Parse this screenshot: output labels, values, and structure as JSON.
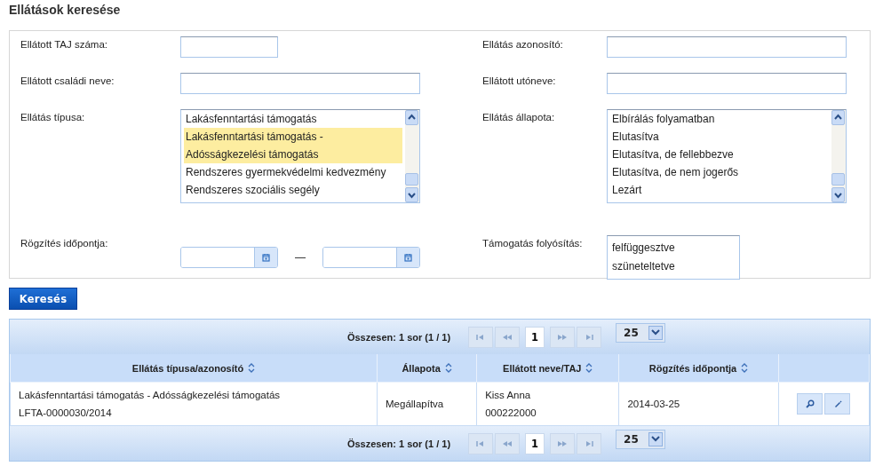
{
  "title": "Ellátások keresése",
  "form_rows": [
    {
      "left": {
        "kind": "text",
        "label": "Ellátott TAJ száma:"
      },
      "right": {
        "kind": "text",
        "label": "Ellátás azonosító:"
      }
    },
    {
      "left": {
        "kind": "text",
        "label": "Ellátott családi neve:"
      },
      "right": {
        "kind": "text",
        "label": "Ellátott utóneve:"
      }
    },
    {
      "left": {
        "kind": "listbox",
        "label": "Ellátás típusa:",
        "items": [
          {
            "text": "Lakásfenntartási támogatás",
            "selected": false
          },
          {
            "text": "Lakásfenntartási támogatás - Adósságkezelési támogatás",
            "selected": true
          },
          {
            "text": "Rendszeres gyermekvédelmi kedvezmény",
            "selected": false
          },
          {
            "text": "Rendszeres szociális segély",
            "selected": false
          }
        ]
      },
      "right": {
        "kind": "listbox",
        "label": "Ellátás állapota:",
        "items": [
          {
            "text": "Elbírálás folyamatban",
            "selected": false
          },
          {
            "text": "Elutasítva",
            "selected": false
          },
          {
            "text": "Elutasítva, de fellebbezve",
            "selected": false
          },
          {
            "text": "Elutasítva, de nem jogerős",
            "selected": false
          },
          {
            "text": "Lezárt",
            "selected": false
          }
        ]
      }
    },
    {
      "left": {
        "kind": "date-range",
        "label": "Rögzítés időpontja:",
        "separator": "—"
      },
      "right": {
        "kind": "list",
        "label": "Támogatás folyósítás:",
        "items": [
          {
            "text": "felfüggesztve",
            "selected": false
          },
          {
            "text": "szüneteltetve",
            "selected": false
          }
        ]
      }
    }
  ],
  "search_button": "Keresés",
  "paginator": {
    "summary": "Összesen: 1 sor (1 / 1)",
    "page": "1",
    "rows_per_page": "25"
  },
  "table": {
    "columns": [
      "Ellátás típusa/azonosító",
      "Állapota",
      "Ellátott neve/TAJ",
      "Rögzítés időpontja",
      ""
    ],
    "rows": [
      {
        "cells": [
          [
            "Lakásfenntartási támogatás - Adósságkezelési támogatás",
            "LFTA-0000030/2014"
          ],
          [
            "Megállapítva"
          ],
          [
            "Kiss Anna",
            "000222000"
          ],
          [
            "2014-03-25"
          ]
        ]
      }
    ]
  },
  "bottom_paginator": {
    "summary": "Összesen: 1 sor (1 / 1)",
    "page": "1",
    "rows_per_page": "25"
  }
}
